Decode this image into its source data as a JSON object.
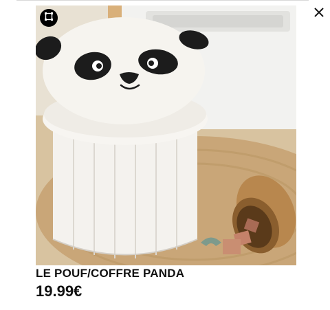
{
  "product": {
    "name": "LE POUF/COFFRE PANDA",
    "price": "19.99€",
    "image_subject": "panda storage pouf"
  },
  "controls": {
    "expand_icon": "expand-frame-icon",
    "close_icon": "close-x-icon"
  },
  "colors": {
    "text": "#111111",
    "icon_button_bg": "#000000",
    "close_icon": "#1a1a1a"
  }
}
